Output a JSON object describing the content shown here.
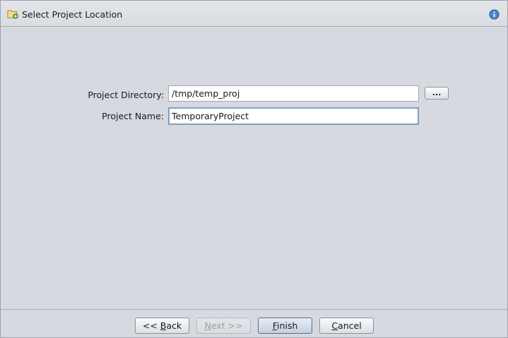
{
  "header": {
    "title": "Select Project Location",
    "icon": "folder-add-icon",
    "info_icon": "info-icon"
  },
  "form": {
    "project_directory": {
      "label": "Project Directory:",
      "value": "/tmp/temp_proj"
    },
    "browse_label": "...",
    "project_name": {
      "label": "Project Name:",
      "value": "TemporaryProject"
    }
  },
  "buttons": {
    "back": {
      "prefix": "<< ",
      "mnemonic": "B",
      "rest": "ack",
      "enabled": true
    },
    "next": {
      "prefix": "",
      "mnemonic": "N",
      "rest": "ext >>",
      "enabled": false
    },
    "finish": {
      "prefix": "",
      "mnemonic": "F",
      "rest": "inish",
      "enabled": true
    },
    "cancel": {
      "prefix": "",
      "mnemonic": "C",
      "rest": "ancel",
      "enabled": true
    }
  },
  "colors": {
    "background": "#d6d9df",
    "focus_border": "#7fa0c6",
    "info_blue": "#2f6fc4"
  }
}
